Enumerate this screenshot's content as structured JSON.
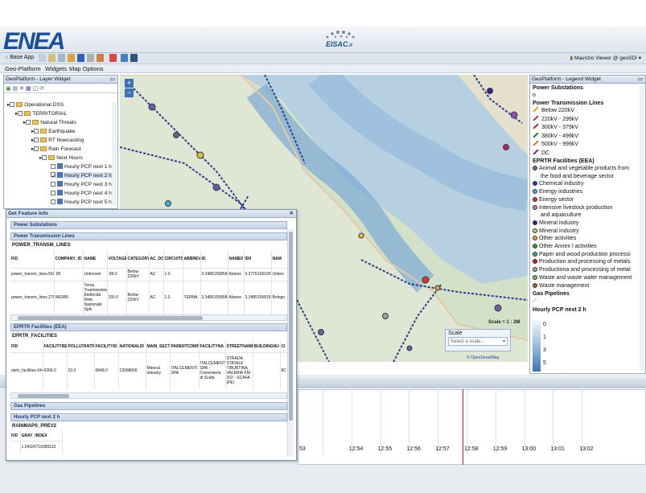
{
  "header": {
    "logo": "ENEA",
    "eisac": "EISAC",
    "eisac_suffix": ".it"
  },
  "toolbar": {
    "base_app": "Base App",
    "user": "Maurizio Viewer @ geoSDI"
  },
  "menu": [
    "Geo-Platform",
    "Widgets",
    "Map Options"
  ],
  "layer_widget": {
    "title": "GeoPlatform - Layer Widget",
    "tree": [
      "Operational DSS",
      "TERRITORIAL",
      "Natural Threats",
      "Earthquake",
      "RT Nowcasting",
      "Rain Forecast",
      "Next Hours",
      "Hourly PCP next 1 h",
      "Hourly PCP next 2 h",
      "Hourly PCP next 3 h",
      "Hourly PCP next 4 h",
      "Hourly PCP next 5 h"
    ]
  },
  "legend": {
    "title": "GeoPlatform - Legend Widget",
    "power_substations": "Power Substations",
    "power_lines": "Power Transmission Lines",
    "lines": [
      {
        "label": "Below 220kV",
        "color": "#e0a020"
      },
      {
        "label": "220kV - 299kV",
        "color": "#c02060"
      },
      {
        "label": "300kV - 379kV",
        "color": "#c02020"
      },
      {
        "label": "380kV - 499kV",
        "color": "#208020"
      },
      {
        "label": "500kV - 999kV",
        "color": "#e07020"
      },
      {
        "label": "DC",
        "color": "#802080"
      }
    ],
    "eprtr": "EPRTR Facilities (EEA)",
    "facilities": [
      {
        "label": "Animal and vegetable products from",
        "color": "#9050b0"
      },
      {
        "label": "the food and beverage sector",
        "color": ""
      },
      {
        "label": "Chemical industry",
        "color": "#2040a0"
      },
      {
        "label": "Energy industries",
        "color": "#40b0d0"
      },
      {
        "label": "Energy sector",
        "color": "#e03030"
      },
      {
        "label": "Intensive livestock production",
        "color": "#d070b0"
      },
      {
        "label": "and aquaculture",
        "color": ""
      },
      {
        "label": "Mineral industry",
        "color": "#302090"
      },
      {
        "label": "Mineral Industry",
        "color": "#d8c040"
      },
      {
        "label": "Other activities",
        "color": "#f0a030"
      },
      {
        "label": "Other Annex I activities",
        "color": "#30a030"
      },
      {
        "label": "Paper and wood production processi",
        "color": "#30b080"
      },
      {
        "label": "Production and processing of metals",
        "color": "#c02020"
      },
      {
        "label": "Productiona and processing of metal",
        "color": "#a0a0a0"
      },
      {
        "label": "Waste and waste water management",
        "color": "#70c040"
      },
      {
        "label": "Waste management",
        "color": "#a06030"
      }
    ],
    "gas": "Gas Pipelines",
    "pcp": "Hourly PCP next 2 h",
    "pcp_values": [
      "0",
      "1",
      "3",
      "5"
    ]
  },
  "map": {
    "scale_label": "Scale = 1 : 2M",
    "scale_title": "Scale",
    "scale_placeholder": "Select a scale...",
    "attribution": "© OpenStreetMap"
  },
  "timeline": {
    "labels": [
      "53",
      "12:54",
      "12:55",
      "12:56",
      "12:57",
      "12:58",
      "12:59",
      "13:00",
      "13:01",
      "13:02"
    ]
  },
  "gfi": {
    "title": "Get Feature Info",
    "sec_power_sub": "Power Substations",
    "sec_power_lines": "Power Transmission Lines",
    "lines_table": "POWER_TRANSM_LINES",
    "lines_cols": [
      "FID",
      "COMPANY_ID",
      "NAME",
      "VOLTAGE",
      "CATEGORY",
      "AC_DC",
      "CIRCUITS",
      "ABBREV",
      "ID",
      "NAME0",
      "ID0",
      "NAM"
    ],
    "lines_rows": [
      [
        "power_transm_lines.5606",
        ".85",
        "Unknown",
        ".89.0",
        "Below 220kV",
        "AC",
        "1.0",
        "",
        "3.34851558589",
        "Alanno",
        "3.37761091959",
        "Unkno"
      ],
      [
        "power_transm_lines.2708",
        "WE589",
        "Terna Trasmissione Elettricità Rete Nazionale SpA",
        "150.0",
        "Below 220kV",
        "AC",
        "1.0",
        "TERNA",
        "3.34851558589",
        "Alanno",
        "3.34851558159",
        "Bologn"
      ]
    ],
    "sec_eprtr": "EPRTR Facilities (EEA)",
    "eprtr_table": "EPRTR_FACILITIES",
    "eprtr_cols": [
      "FID",
      "FACILITYRE",
      "POLLUTANTR",
      "FACILITYID",
      "NATIONALID",
      "MAIN_SECT",
      "PARENTCOMP",
      "FACILITYNA",
      "STREETNAME",
      "BUILDINGNU",
      "CI"
    ],
    "eprtr_rows": [
      [
        "eprtr_facilities.644",
        "6266.0",
        "23.0",
        "6848.0",
        "13068006",
        "Mineral industry",
        "ITALCEMENTI SPA",
        "ITALCEMENTI SPA - Cementeria di Scafa",
        "STRADA STATALE TIBURTINA VALERIA KM 202 - SCAFA (PE)",
        "",
        "8C"
      ]
    ],
    "sec_gas": "Gas Pipelines",
    "sec_pcp": "Hourly PCP next 2 h",
    "rain_table": "RAINMAPS_PREV2",
    "rain_cols": [
      "FID",
      "GRAY_INDEX"
    ],
    "rain_rows": [
      [
        "",
        "1.04324710389110"
      ]
    ]
  }
}
